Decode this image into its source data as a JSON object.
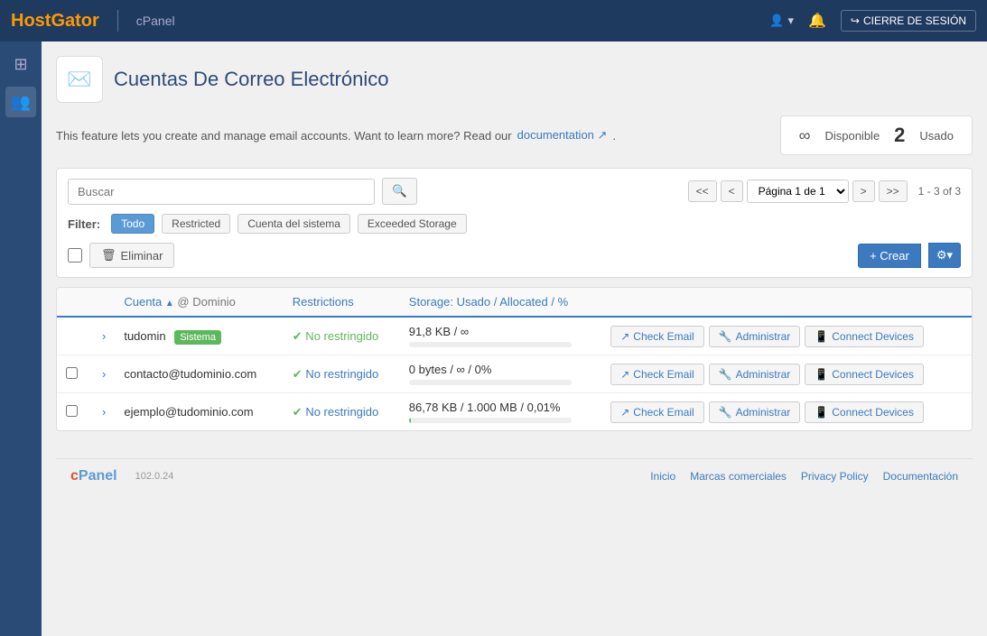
{
  "topnav": {
    "logo": "HostGator",
    "cpanel": "cPanel",
    "signout": "CIERRE DE SESIÓN"
  },
  "sidebar": {
    "icons": [
      "⊞",
      "👥"
    ]
  },
  "page": {
    "title": "Cuentas De Correo Electrónico",
    "info_text": "This feature lets you create and manage email accounts. Want to learn more? Read our",
    "doc_link": "documentation",
    "available_label": "Disponible",
    "available_symbol": "∞",
    "used_label": "Usado",
    "used_count": "2"
  },
  "search": {
    "placeholder": "Buscar"
  },
  "pagination": {
    "page_label": "Página 1 de 1",
    "count": "1 - 3 of 3"
  },
  "filter": {
    "label": "Filter:",
    "buttons": [
      "Todo",
      "Restricted",
      "Cuenta del sistema",
      "Exceeded Storage"
    ]
  },
  "actions": {
    "delete_label": "Eliminar",
    "create_label": "+ Crear"
  },
  "table": {
    "columns": [
      "Cuenta",
      "@ Dominio",
      "Restrictions",
      "Storage: Usado / Allocated / %"
    ],
    "rows": [
      {
        "id": 1,
        "account": "tudomin",
        "badge": "Sistema",
        "domain": "",
        "restriction": "No restringido",
        "restriction_type": "ok",
        "storage": "91,8 KB / ∞",
        "storage_pct": 0,
        "check_email": "Check Email",
        "administrar": "Administrar",
        "connect": "Connect Devices"
      },
      {
        "id": 2,
        "account": "contacto",
        "badge": "",
        "domain": "@tudominio.com",
        "restriction": "No restringido",
        "restriction_type": "link",
        "storage": "0 bytes / ∞ / 0%",
        "storage_pct": 0,
        "check_email": "Check Email",
        "administrar": "Administrar",
        "connect": "Connect Devices"
      },
      {
        "id": 3,
        "account": "ejemplo",
        "badge": "",
        "domain": "@tudominio.com",
        "restriction": "No restringido",
        "restriction_type": "link",
        "storage": "86,78 KB / 1.000 MB / 0,01%",
        "storage_pct": 0.01,
        "check_email": "Check Email",
        "administrar": "Administrar",
        "connect": "Connect Devices"
      }
    ]
  },
  "footer": {
    "logo": "cPanel",
    "version": "102.0.24",
    "links": [
      "Inicio",
      "Marcas comerciales",
      "Privacy Policy",
      "Documentación"
    ]
  }
}
